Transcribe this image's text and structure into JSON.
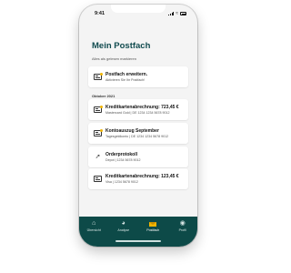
{
  "status_bar": {
    "time": "9:41"
  },
  "page": {
    "title": "Mein Postfach",
    "mark_all_read": "Alles als gelesen markieren"
  },
  "promo": {
    "title": "Postfach erweitern.",
    "subtitle": "Aktivieren Sie Ihr Postfach!"
  },
  "section": {
    "label": "Oktober 2021"
  },
  "messages": [
    {
      "title": "Kreditkartenabrechnung: 723,45 €",
      "subtitle": "Mastercard Gold | DE 1234 1234 5678 9012",
      "icon": "envelope-icon",
      "unread": true
    },
    {
      "title": "Kontoauszug September",
      "subtitle": "Tagesgeldkonto | DE 1234 1234 5678 9012",
      "icon": "envelope-icon",
      "unread": true
    },
    {
      "title": "Orderprotokoll",
      "subtitle": "Depot | 1234 5678 9012",
      "icon": "chart-icon",
      "unread": false
    },
    {
      "title": "Kreditkartenabrechnung: 123,45 €",
      "subtitle": "Visa | 1234 5678 9012",
      "icon": "envelope-icon",
      "unread": false
    }
  ],
  "tabbar": {
    "tabs": [
      {
        "label": "Übersicht",
        "icon": "home-icon"
      },
      {
        "label": "Analyse",
        "icon": "analysis-icon"
      },
      {
        "label": "Postfach",
        "icon": "mail-icon",
        "active": true
      },
      {
        "label": "Profil",
        "icon": "profile-icon"
      }
    ]
  },
  "colors": {
    "brand": "#114b4f",
    "tabbar": "#0d4a48",
    "accent": "#f0b400"
  }
}
